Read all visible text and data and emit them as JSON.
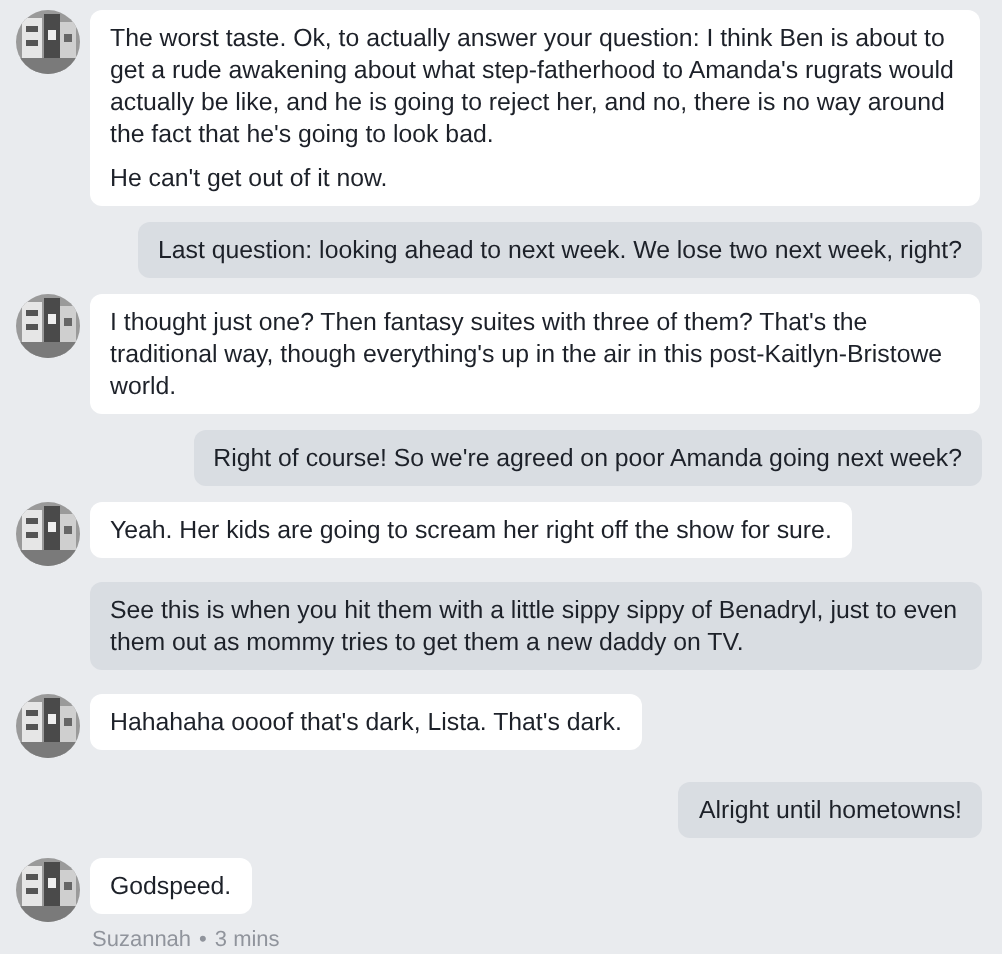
{
  "messages": [
    {
      "kind": "incoming",
      "avatar": {
        "kind": "picture"
      },
      "paragraphs": [
        "The worst taste. Ok, to actually answer your question: I think Ben is about to get a rude awakening about what step-fatherhood to Amanda's rugrats would actually be like, and he is going to reject her, and no, there is no way around the fact that he's going to look bad.",
        "He can't get out of it now."
      ]
    },
    {
      "kind": "outgoing",
      "paragraphs": [
        "Last question: looking ahead to next week. We lose two next week, right?"
      ]
    },
    {
      "kind": "incoming",
      "avatar": {
        "kind": "picture"
      },
      "paragraphs": [
        "I thought just one? Then fantasy suites with three of them? That's the traditional way, though everything's up in the air in this post-Kaitlyn-Bristowe world."
      ]
    },
    {
      "kind": "outgoing",
      "paragraphs": [
        "Right of course! So we're agreed on poor Amanda going next week?"
      ]
    },
    {
      "kind": "incoming",
      "avatar": {
        "kind": "picture"
      },
      "paragraphs": [
        "Yeah. Her kids are going to scream her right off the show for sure."
      ]
    },
    {
      "kind": "outgoing",
      "paragraphs": [
        "See this is when you hit them with a little sippy sippy of Benadryl, just to even them out as mommy tries to get them a new daddy on TV."
      ]
    },
    {
      "kind": "incoming",
      "avatar": {
        "kind": "picture"
      },
      "paragraphs": [
        "Hahahaha oooof that's dark, Lista. That's dark."
      ]
    },
    {
      "kind": "outgoing",
      "paragraphs": [
        "Alright until hometowns!"
      ]
    },
    {
      "kind": "incoming",
      "avatar": {
        "kind": "picture"
      },
      "paragraphs": [
        "Godspeed."
      ]
    }
  ],
  "footer": {
    "sender": "Suzannah",
    "separator": "•",
    "time": "3 mins"
  }
}
